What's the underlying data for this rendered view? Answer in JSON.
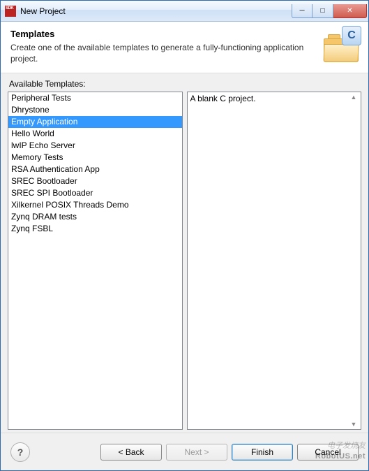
{
  "window": {
    "title": "New Project"
  },
  "header": {
    "title": "Templates",
    "description": "Create one of the available templates to generate a fully-functioning application project.",
    "badge_letter": "C"
  },
  "available_label": "Available Templates:",
  "templates": [
    "Peripheral Tests",
    "Dhrystone",
    "Empty Application",
    "Hello World",
    "lwIP Echo Server",
    "Memory Tests",
    "RSA Authentication App",
    "SREC Bootloader",
    "SREC SPI Bootloader",
    "Xilkernel POSIX Threads Demo",
    "Zynq DRAM tests",
    "Zynq FSBL"
  ],
  "selected_index": 2,
  "description_text": "A blank C project.",
  "buttons": {
    "back": "< Back",
    "next": "Next >",
    "finish": "Finish",
    "cancel": "Cancel",
    "help": "?"
  },
  "watermarks": {
    "top": "电子发烧友",
    "bottom": "RobotUS.net"
  }
}
